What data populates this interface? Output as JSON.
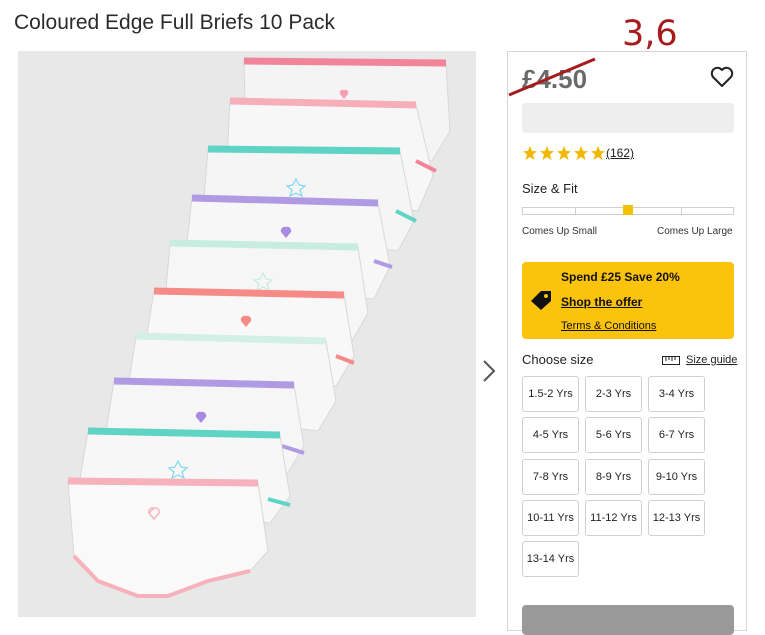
{
  "product": {
    "title": "Coloured Edge Full Briefs 10 Pack"
  },
  "annotation": {
    "text": "3,6"
  },
  "price": {
    "value": "£4.50"
  },
  "rating": {
    "stars": 5,
    "count": "(162)"
  },
  "fit": {
    "label": "Size & Fit",
    "left": "Comes Up Small",
    "right": "Comes Up Large",
    "level": 0.5
  },
  "offer": {
    "title": "Spend £25 Save 20%",
    "link": "Shop the offer",
    "terms": "Terms & Conditions"
  },
  "size": {
    "label": "Choose size",
    "guide": "Size guide",
    "options": [
      "1.5-2 Yrs",
      "2-3 Yrs",
      "3-4 Yrs",
      "4-5 Yrs",
      "5-6 Yrs",
      "6-7 Yrs",
      "7-8 Yrs",
      "8-9 Yrs",
      "9-10 Yrs",
      "10-11 Yrs",
      "11-12 Yrs",
      "12-13 Yrs",
      "13-14 Yrs"
    ]
  },
  "colors": {
    "accent_yellow": "#fbc30b",
    "star": "#f2b800",
    "annotation_red": "#a61c1c",
    "price_grey": "#6a6a6a"
  },
  "icons": [
    "heart-icon",
    "star-icon",
    "price-tag-icon",
    "ruler-icon",
    "chevron-right-icon"
  ]
}
